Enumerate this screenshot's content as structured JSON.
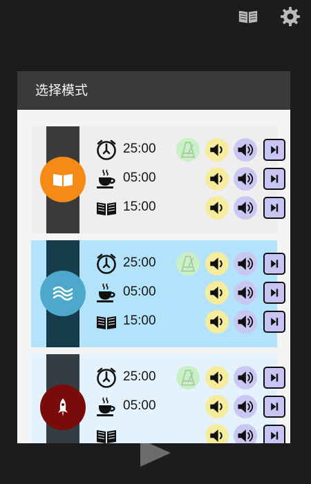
{
  "dialog": {
    "title": "选择模式"
  },
  "top_icons": [
    "book-icon",
    "gear-icon"
  ],
  "colors": {
    "background": "#1c1c1c",
    "dialog_header": "#3a3a3a",
    "mode1_bg": "#eeeeee",
    "mode1_badge": "#f58a17",
    "mode2_bg": "#b3e3fb",
    "mode2_badge": "#4ea8cc",
    "mode3_bg": "#e3f2fd",
    "mode3_badge": "#7a0b0b",
    "metronome_bg": "#c9efc4",
    "volume_yellow": "#f6ec9d",
    "volume_purple": "#cbc7f3"
  },
  "modes": [
    {
      "icon": "book-icon",
      "rows": [
        {
          "icon": "clock-icon",
          "time": "25:00"
        },
        {
          "icon": "coffee-icon",
          "time": "05:00"
        },
        {
          "icon": "book-icon",
          "time": "15:00"
        }
      ]
    },
    {
      "icon": "waves-icon",
      "rows": [
        {
          "icon": "clock-icon",
          "time": "25:00"
        },
        {
          "icon": "coffee-icon",
          "time": "05:00"
        },
        {
          "icon": "book-icon",
          "time": "15:00"
        }
      ]
    },
    {
      "icon": "rocket-icon",
      "rows": [
        {
          "icon": "clock-icon",
          "time": "25:00"
        },
        {
          "icon": "coffee-icon",
          "time": "05:00"
        }
      ]
    }
  ]
}
